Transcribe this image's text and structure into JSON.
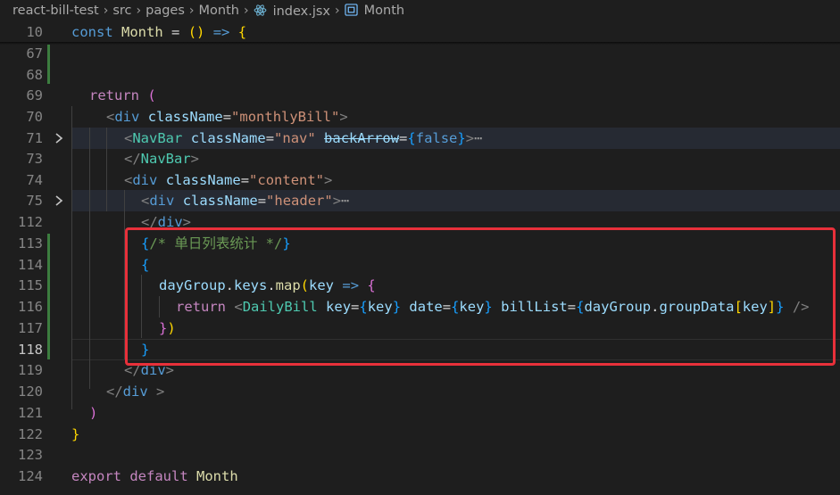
{
  "breadcrumb": {
    "items": [
      "react-bill-test",
      "src",
      "pages",
      "Month",
      "index.jsx",
      "Month"
    ],
    "icons": [
      "",
      "",
      "",
      "",
      "react-icon",
      "symbol-variable-icon"
    ]
  },
  "sticky": {
    "line_number": "10",
    "text": "const Month = () => {"
  },
  "lines": [
    {
      "n": "67",
      "text": ""
    },
    {
      "n": "68",
      "text": ""
    },
    {
      "n": "69",
      "text": "return ("
    },
    {
      "n": "70",
      "text": "<div className=\"monthlyBill\">"
    },
    {
      "n": "71",
      "text": "<NavBar className=\"nav\" backArrow={false}>⋯",
      "folded": true
    },
    {
      "n": "73",
      "text": "</NavBar>"
    },
    {
      "n": "74",
      "text": "<div className=\"content\">"
    },
    {
      "n": "75",
      "text": "<div className=\"header\">⋯",
      "folded": true
    },
    {
      "n": "112",
      "text": "</div>"
    },
    {
      "n": "113",
      "text": "{/* 单日列表统计 */}"
    },
    {
      "n": "114",
      "text": "{"
    },
    {
      "n": "115",
      "text": "dayGroup.keys.map(key => {"
    },
    {
      "n": "116",
      "text": "return <DailyBill key={key} date={key} billList={dayGroup.groupData[key]} />"
    },
    {
      "n": "117",
      "text": "})"
    },
    {
      "n": "118",
      "text": "}",
      "active": true
    },
    {
      "n": "119",
      "text": "</div>"
    },
    {
      "n": "120",
      "text": "</div >"
    },
    {
      "n": "121",
      "text": ")"
    },
    {
      "n": "122",
      "text": "}"
    },
    {
      "n": "123",
      "text": ""
    },
    {
      "n": "124",
      "text": "export default Month"
    }
  ],
  "colors": {
    "annotation": "#e8303a",
    "background": "#1e1e1e",
    "modified_gutter": "#3c7d3f"
  }
}
